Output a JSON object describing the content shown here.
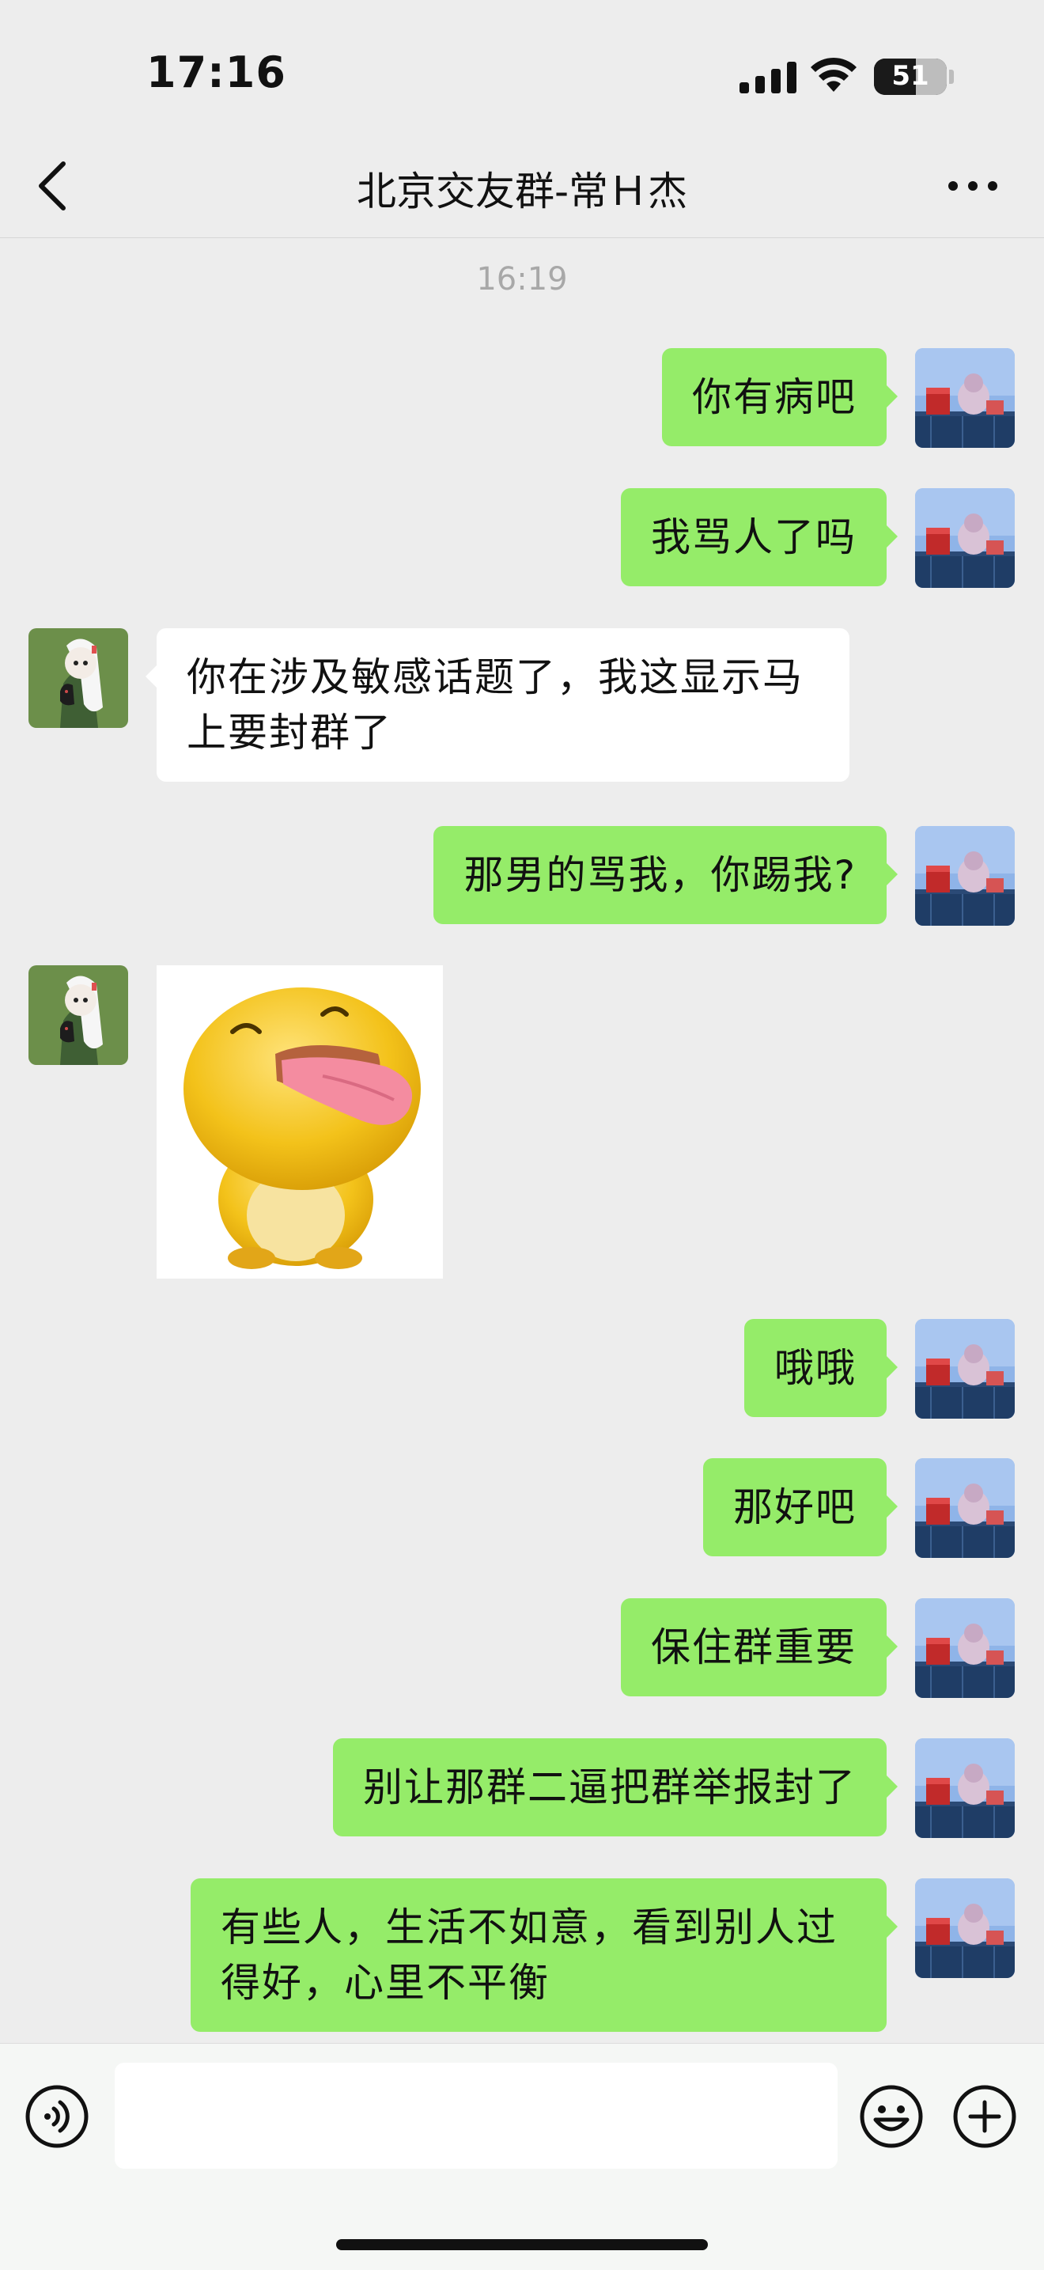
{
  "status_bar": {
    "time": "17:16",
    "battery": "51",
    "battery_level": 0.51
  },
  "nav": {
    "title": "北京交友群-常Ｈ杰"
  },
  "chat": {
    "timestamp": "16:19",
    "messages": [
      {
        "from": "me",
        "text": "你有病吧"
      },
      {
        "from": "me",
        "text": "我骂人了吗"
      },
      {
        "from": "other",
        "text": "你在涉及敏感话题了，我这显示马上要封群了"
      },
      {
        "from": "me",
        "text": "那男的骂我，你踢我?"
      },
      {
        "from": "other",
        "type": "sticker",
        "icon": "yellow-duck-tongue-sticker"
      },
      {
        "from": "me",
        "text": "哦哦"
      },
      {
        "from": "me",
        "text": "那好吧"
      },
      {
        "from": "me",
        "text": "保住群重要"
      },
      {
        "from": "me",
        "text": "别让那群二逼把群举报封了"
      },
      {
        "from": "me",
        "text": "有些人，生活不如意，看到别人过得好，心里不平衡"
      }
    ]
  },
  "colors": {
    "my_bubble": "#95EC69",
    "other_bubble": "#FFFFFF",
    "background": "#EDEDED"
  },
  "icons": {
    "back": "chevron-left-icon",
    "more": "more-dots-icon",
    "voice": "voice-input-icon",
    "emoji": "emoji-icon",
    "plus": "plus-icon"
  }
}
